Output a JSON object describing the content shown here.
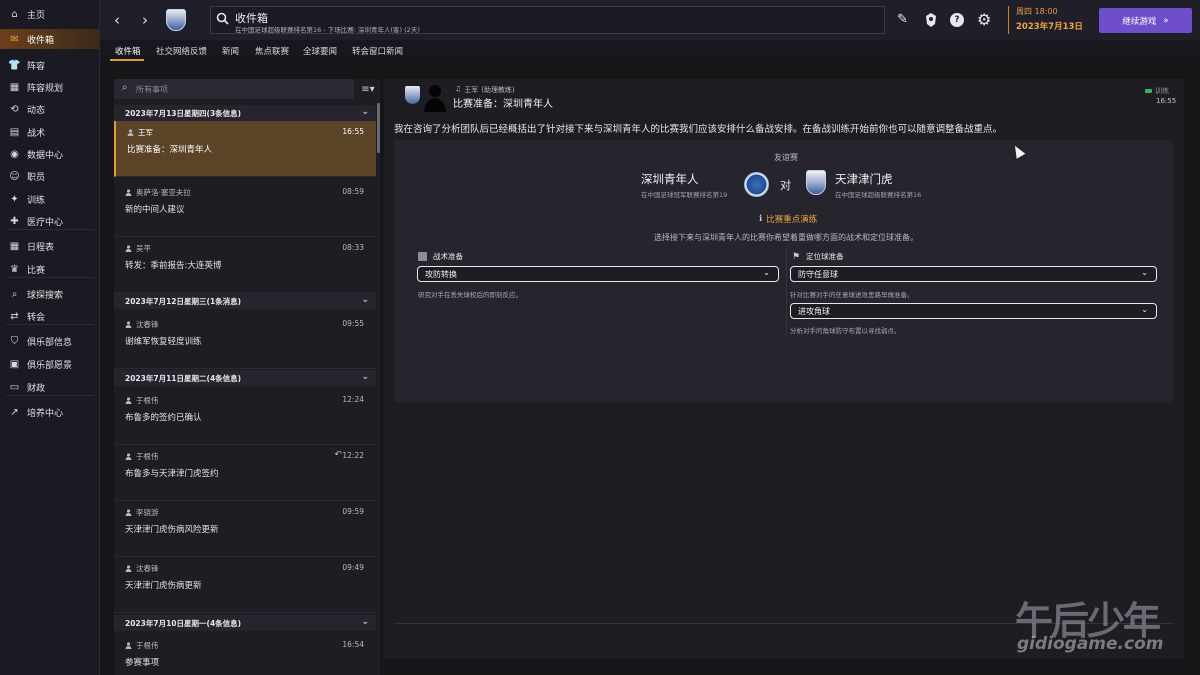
{
  "nav": {
    "items": [
      {
        "label": "主页",
        "icon": "home-icon"
      },
      {
        "label": "收件箱",
        "icon": "inbox-icon",
        "active": true
      },
      {
        "label": "阵容",
        "icon": "shirt-icon"
      },
      {
        "label": "阵容规划",
        "icon": "squad-planner-icon"
      },
      {
        "label": "动态",
        "icon": "dynamics-icon"
      },
      {
        "label": "战术",
        "icon": "tactics-icon"
      },
      {
        "label": "数据中心",
        "icon": "data-hub-icon"
      },
      {
        "label": "职员",
        "icon": "staff-icon"
      },
      {
        "label": "训练",
        "icon": "training-icon"
      },
      {
        "label": "医疗中心",
        "icon": "medical-icon"
      },
      {
        "label": "日程表",
        "icon": "calendar-icon"
      },
      {
        "label": "比赛",
        "icon": "trophy-icon"
      },
      {
        "label": "球探搜索",
        "icon": "scouting-icon"
      },
      {
        "label": "转会",
        "icon": "transfer-icon"
      },
      {
        "label": "俱乐部信息",
        "icon": "club-info-icon"
      },
      {
        "label": "俱乐部愿景",
        "icon": "club-vision-icon"
      },
      {
        "label": "财政",
        "icon": "finance-icon"
      },
      {
        "label": "培养中心",
        "icon": "development-icon"
      }
    ]
  },
  "topbar": {
    "title": "收件箱",
    "subtitle": "在中国足球超级联赛排名第16 - 下场比赛: 深圳青年人(客) (2天)",
    "date_line1": "周四 18:00",
    "date_line2": "2023年7月13日",
    "continue_label": "继续游戏"
  },
  "tabs": [
    "收件箱",
    "社交网络反馈",
    "新闻",
    "焦点联赛",
    "全球要闻",
    "转会窗口新闻"
  ],
  "list": {
    "search_placeholder": "所有事项",
    "groups": [
      {
        "header": "2023年7月13日星期四(3条信息)",
        "messages": [
          {
            "sender": "王军",
            "time": "16:55",
            "subject": "比赛准备：深圳青年人",
            "selected": true
          },
          {
            "sender": "奥萨洛·塞亚夫拉",
            "time": "08:59",
            "subject": "新的中间人建议"
          },
          {
            "sender": "吴平",
            "time": "08:33",
            "subject": "转发：季前报告:大连英博"
          }
        ]
      },
      {
        "header": "2023年7月12日星期三(1条消息)",
        "messages": [
          {
            "sender": "沈春锋",
            "time": "09:55",
            "subject": "谢维军恢复轻度训练"
          }
        ]
      },
      {
        "header": "2023年7月11日星期二(4条信息)",
        "messages": [
          {
            "sender": "于根伟",
            "time": "12:24",
            "subject": "布鲁多的签约已确认"
          },
          {
            "sender": "于根伟",
            "time": "12:22",
            "subject": "布鲁多与天津津门虎签约",
            "replied": true
          },
          {
            "sender": "李骁游",
            "time": "09:59",
            "subject": "天津津门虎伤病风险更新"
          },
          {
            "sender": "沈春锋",
            "time": "09:49",
            "subject": "天津津门虎伤病更新"
          }
        ]
      },
      {
        "header": "2023年7月10日星期一(4条信息)",
        "messages": [
          {
            "sender": "于根伟",
            "time": "16:54",
            "subject": "参赛事项"
          }
        ]
      }
    ]
  },
  "reader": {
    "sender_name": "王军",
    "sender_role": "(助理教练)",
    "subject": "比赛准备：深圳青年人",
    "tag": "训练",
    "time": "16:55",
    "body": "我在咨询了分析团队后已经概括出了针对接下来与深圳青年人的比赛我们应该安排什么备战安排。在备战训练开始前你也可以随意调整备战重点。",
    "match_type": "友谊赛",
    "home_team": "深圳青年人",
    "home_sub": "在中国足球冠军联赛排名第19",
    "vs": "对",
    "away_team": "天津津门虎",
    "away_sub": "在中国足球超级联赛排名第16",
    "focus_title": "比赛重点演练",
    "focus_desc": "选择接下来与深圳青年人的比赛你希望着重做哪方面的战术和定位球准备。",
    "tactical_head": "战术准备",
    "tactical_value": "攻防转换",
    "tactical_note": "研究对手在丢失球权后的即刻反应。",
    "setpiece_head": "定位球准备",
    "setpiece_value1": "防守任意球",
    "setpiece_note1": "针对比赛对手的任意球进攻思路早做准备。",
    "setpiece_value2": "进攻角球",
    "setpiece_note2": "分析对手的角球防守布置以寻找弱点。"
  },
  "watermark": {
    "cn": "午后少年",
    "en": "gidiogame.com"
  },
  "colors": {
    "accent": "#e59a3a",
    "button": "#6f4fc9",
    "selected_row": "#5a4326"
  }
}
